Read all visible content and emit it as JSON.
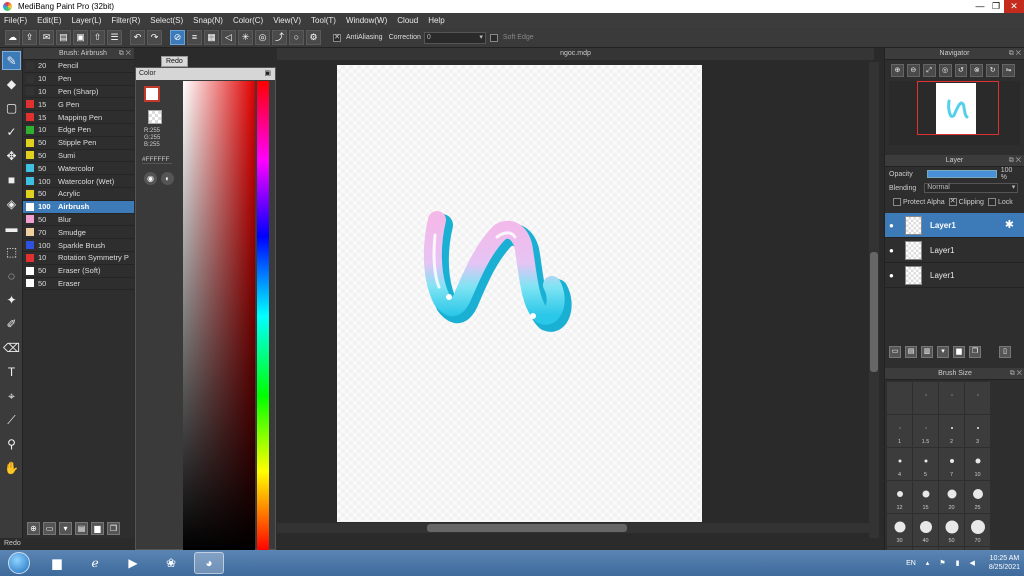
{
  "window": {
    "title": "MediBang Paint Pro (32bit)"
  },
  "menu": [
    "File(F)",
    "Edit(E)",
    "Layer(L)",
    "Filter(R)",
    "Select(S)",
    "Snap(N)",
    "Color(C)",
    "View(V)",
    "Tool(T)",
    "Window(W)",
    "Cloud",
    "Help"
  ],
  "toolbar": {
    "antialiasing_label": "AntiAliasing",
    "correction_label": "Correction",
    "correction_value": "0",
    "soft_edge_label": "Soft Edge"
  },
  "tooltip": "Redo",
  "brush_panel": {
    "title": "Brush: Airbrush",
    "items": [
      {
        "size": "20",
        "name": "Pencil",
        "color": "#333333"
      },
      {
        "size": "10",
        "name": "Pen",
        "color": "#333333"
      },
      {
        "size": "10",
        "name": "Pen (Sharp)",
        "color": "#333333"
      },
      {
        "size": "15",
        "name": "G Pen",
        "color": "#e03030"
      },
      {
        "size": "15",
        "name": "Mapping Pen",
        "color": "#e03030"
      },
      {
        "size": "10",
        "name": "Edge Pen",
        "color": "#30b030"
      },
      {
        "size": "50",
        "name": "Stipple Pen",
        "color": "#e0d020"
      },
      {
        "size": "50",
        "name": "Sumi",
        "color": "#e0d020"
      },
      {
        "size": "50",
        "name": "Watercolor",
        "color": "#40c0e0"
      },
      {
        "size": "100",
        "name": "Watercolor (Wet)",
        "color": "#40c0e0"
      },
      {
        "size": "50",
        "name": "Acrylic",
        "color": "#e0d020"
      },
      {
        "size": "100",
        "name": "Airbrush",
        "color": "#ffffff"
      },
      {
        "size": "50",
        "name": "Blur",
        "color": "#f0a0d0"
      },
      {
        "size": "70",
        "name": "Smudge",
        "color": "#f0d0a0"
      },
      {
        "size": "100",
        "name": "Sparkle Brush",
        "color": "#3050e0"
      },
      {
        "size": "10",
        "name": "Rotation Symmetry P",
        "color": "#e03030"
      },
      {
        "size": "50",
        "name": "Eraser (Soft)",
        "color": "#ffffff"
      },
      {
        "size": "50",
        "name": "Eraser",
        "color": "#ffffff"
      }
    ]
  },
  "color_panel": {
    "title": "Color",
    "r": "R:255",
    "g": "G:255",
    "b": "B:255",
    "hex": "#FFFFFF"
  },
  "document": {
    "tab": "ngoc.mdp"
  },
  "navigator": {
    "title": "Navigator"
  },
  "layer_panel": {
    "title": "Layer",
    "opacity_label": "Opacity",
    "opacity_value": "100 %",
    "opacity": 1.0,
    "blending_label": "Blending",
    "blending_value": "Normal",
    "protect_alpha": "Protect Alpha",
    "clipping": "Clipping",
    "lock": "Lock",
    "layers": [
      {
        "name": "Layer1",
        "selected": true
      },
      {
        "name": "Layer1",
        "selected": false
      },
      {
        "name": "Layer1",
        "selected": false
      }
    ]
  },
  "brush_size": {
    "title": "Brush Size",
    "sizes": [
      "",
      "",
      "",
      "",
      "1",
      "1.5",
      "2",
      "3",
      "4",
      "5",
      "7",
      "10",
      "12",
      "15",
      "20",
      "25",
      "30",
      "40",
      "50",
      "70",
      "100",
      "150",
      "200",
      "300"
    ]
  },
  "status": "Redo",
  "tray": {
    "lang": "EN",
    "time": "10:25 AM",
    "date": "8/25/2021"
  }
}
